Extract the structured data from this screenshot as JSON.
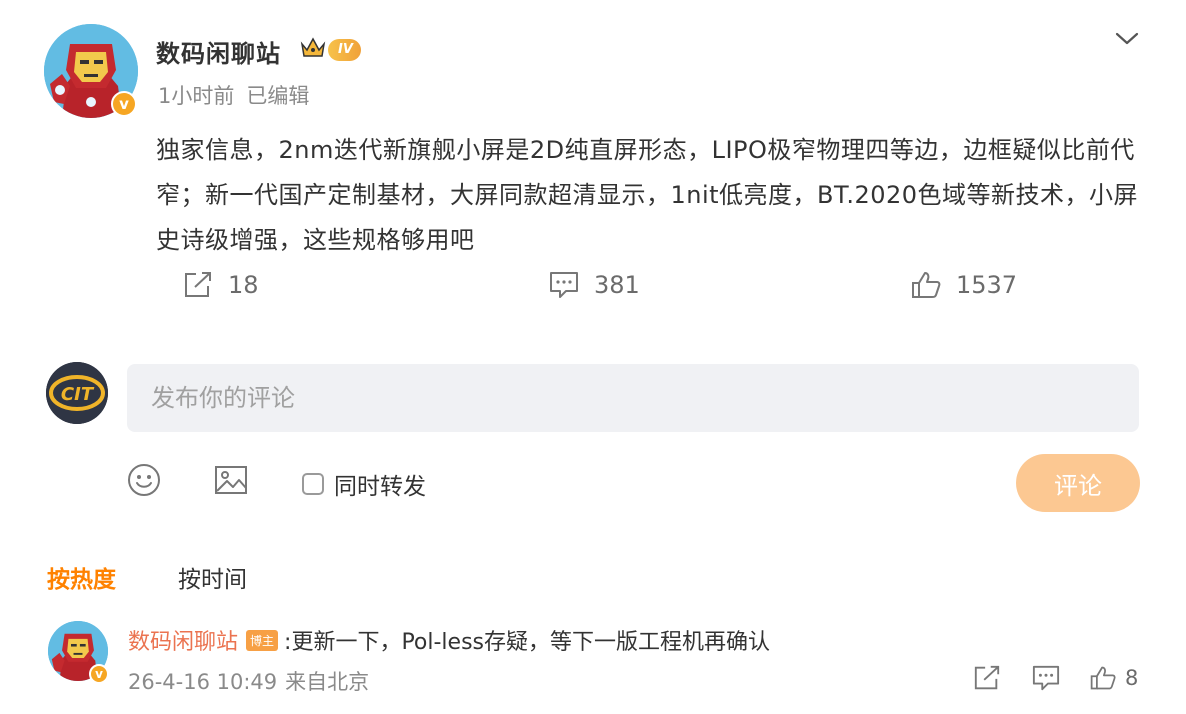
{
  "post": {
    "author": "数码闲聊站",
    "level_badge": "IV",
    "verified_badge": "v",
    "time": "1小时前",
    "edited": "已编辑",
    "text": "独家信息，2nm迭代新旗舰小屏是2D纯直屏形态，LIPO极窄物理四等边，边框疑似比前代窄；新一代国产定制基材，大屏同款超清显示，1nit低亮度，BT.2020色域等新技术，小屏史诗级增强，这些规格够用吧",
    "repost_count": "18",
    "comment_count": "381",
    "like_count": "1537"
  },
  "composer": {
    "placeholder": "发布你的评论",
    "my_avatar_text": "CIT",
    "repost_label": "同时转发",
    "submit_label": "评论"
  },
  "sort": {
    "hot_label": "按热度",
    "time_label": "按时间"
  },
  "comment": {
    "author": "数码闲聊站",
    "tag": "博主",
    "text": ":更新一下，Pol-less存疑，等下一版工程机再确认",
    "date": "26-4-16 10:49",
    "source": "来自北京",
    "like_count": "8"
  },
  "colors": {
    "accent": "#ff8200",
    "author_link": "#eb7350",
    "submit_disabled": "#fcc892"
  }
}
